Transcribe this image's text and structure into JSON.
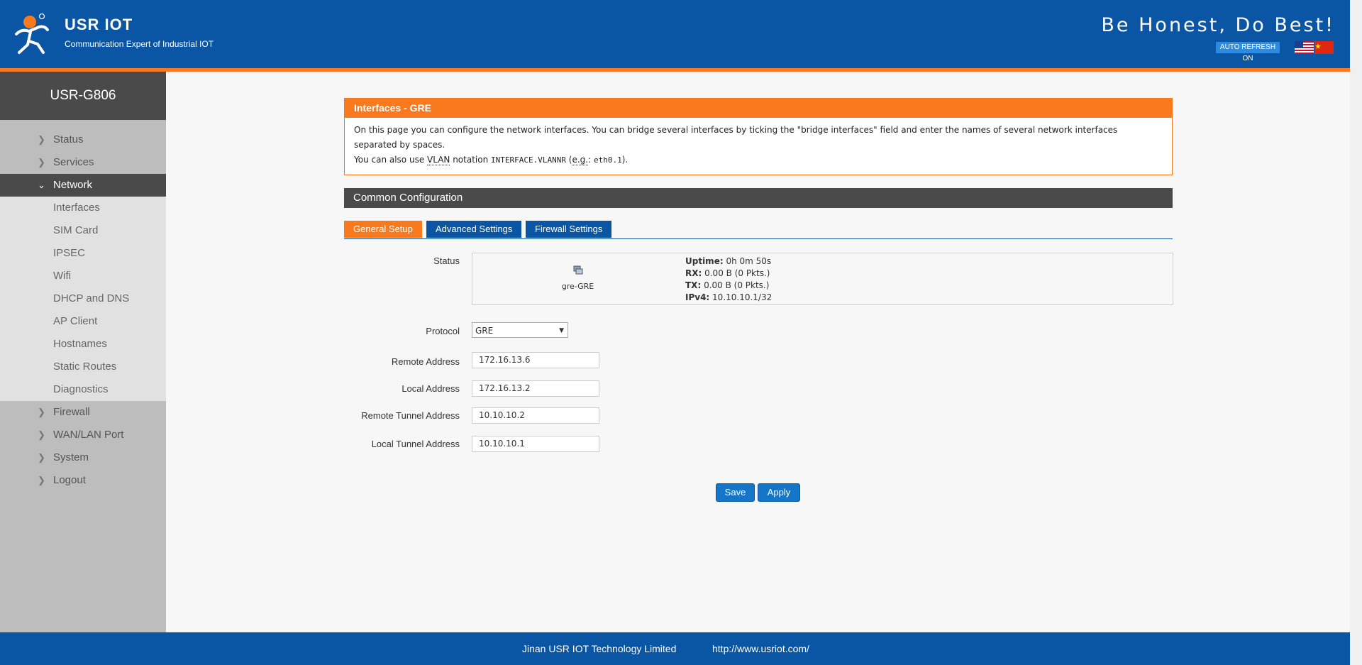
{
  "header": {
    "brand": "USR IOT",
    "subtitle": "Communication Expert of Industrial IOT",
    "slogan": "Be Honest, Do Best!",
    "auto_refresh": "AUTO REFRESH ON"
  },
  "sidebar": {
    "device": "USR-G806",
    "items_top": [
      {
        "label": "Status"
      },
      {
        "label": "Services"
      },
      {
        "label": "Network"
      }
    ],
    "network_sub": [
      {
        "label": "Interfaces"
      },
      {
        "label": "SIM Card"
      },
      {
        "label": "IPSEC"
      },
      {
        "label": "Wifi"
      },
      {
        "label": "DHCP and DNS"
      },
      {
        "label": "AP Client"
      },
      {
        "label": "Hostnames"
      },
      {
        "label": "Static Routes"
      },
      {
        "label": "Diagnostics"
      }
    ],
    "items_bottom": [
      {
        "label": "Firewall"
      },
      {
        "label": "WAN/LAN Port"
      },
      {
        "label": "System"
      },
      {
        "label": "Logout"
      }
    ]
  },
  "info": {
    "title": "Interfaces - GRE",
    "line1": "On this page you can configure the network interfaces. You can bridge several interfaces by ticking the \"bridge interfaces\" field and enter the names of several network interfaces separated by spaces.",
    "line2_prefix": "You can also use ",
    "vlan": "VLAN",
    "line2_mid": " notation ",
    "code1": "INTERFACE.VLANNR",
    "paren_open": " (",
    "eg": "e.g.",
    "colon": ": ",
    "code2": "eth0.1",
    "paren_close": ")."
  },
  "section": {
    "title": "Common Configuration"
  },
  "tabs": {
    "general": "General Setup",
    "advanced": "Advanced Settings",
    "firewall": "Firewall Settings"
  },
  "form": {
    "status_label": "Status",
    "iface_name": "gre-GRE",
    "uptime_k": "Uptime:",
    "uptime_v": " 0h 0m 50s",
    "rx_k": "RX:",
    "rx_v": " 0.00 B (0 Pkts.)",
    "tx_k": "TX:",
    "tx_v": " 0.00 B (0 Pkts.)",
    "ipv4_k": "IPv4:",
    "ipv4_v": " 10.10.10.1/32",
    "protocol_label": "Protocol",
    "protocol_value": "GRE",
    "remote_addr_label": "Remote Address",
    "remote_addr_value": "172.16.13.6",
    "local_addr_label": "Local Address",
    "local_addr_value": "172.16.13.2",
    "remote_tunnel_label": "Remote Tunnel Address",
    "remote_tunnel_value": "10.10.10.2",
    "local_tunnel_label": "Local Tunnel Address",
    "local_tunnel_value": "10.10.10.1"
  },
  "buttons": {
    "save": "Save",
    "apply": "Apply"
  },
  "footer": {
    "company": "Jinan USR IOT Technology Limited",
    "url": "http://www.usriot.com/"
  },
  "colors": {
    "primary_blue": "#0a55a4",
    "accent_orange": "#f97a1e",
    "sidebar_dark": "#4a4a4a"
  }
}
